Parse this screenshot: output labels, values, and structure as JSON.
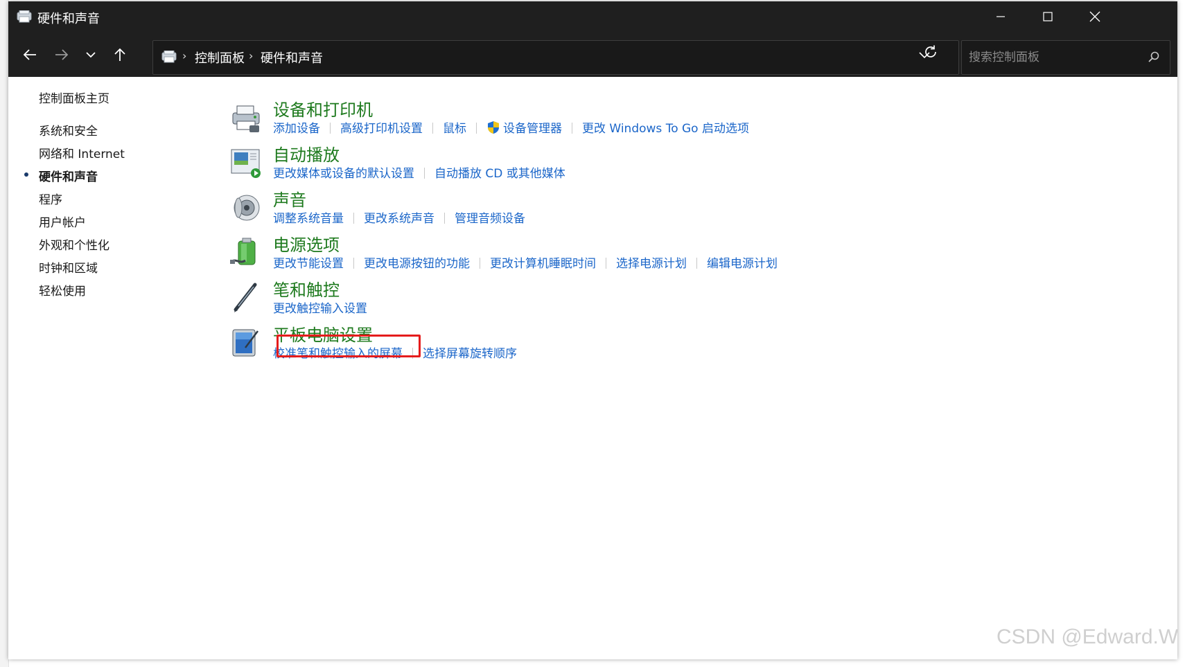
{
  "window": {
    "title": "硬件和声音",
    "controls": {
      "minimize_icon": "minimize-icon",
      "maximize_icon": "maximize-icon",
      "close_icon": "close-icon"
    }
  },
  "navbar": {
    "breadcrumb": [
      "控制面板",
      "硬件和声音"
    ],
    "search_placeholder": "搜索控制面板"
  },
  "sidebar": {
    "home": "控制面板主页",
    "items": [
      {
        "label": "系统和安全",
        "active": false
      },
      {
        "label": "网络和 Internet",
        "active": false
      },
      {
        "label": "硬件和声音",
        "active": true
      },
      {
        "label": "程序",
        "active": false
      },
      {
        "label": "用户帐户",
        "active": false
      },
      {
        "label": "外观和个性化",
        "active": false
      },
      {
        "label": "时钟和区域",
        "active": false
      },
      {
        "label": "轻松使用",
        "active": false
      }
    ]
  },
  "categories": [
    {
      "title": "设备和打印机",
      "icon": "printer-icon",
      "links": [
        "添加设备",
        "高级打印机设置",
        "鼠标",
        "设备管理器",
        "更改 Windows To Go 启动选项"
      ]
    },
    {
      "title": "自动播放",
      "icon": "autoplay-icon",
      "links": [
        "更改媒体或设备的默认设置",
        "自动播放 CD 或其他媒体"
      ]
    },
    {
      "title": "声音",
      "icon": "speaker-icon",
      "links": [
        "调整系统音量",
        "更改系统声音",
        "管理音频设备"
      ]
    },
    {
      "title": "电源选项",
      "icon": "battery-icon",
      "links": [
        "更改节能设置",
        "更改电源按钮的功能",
        "更改计算机睡眠时间",
        "选择电源计划",
        "编辑电源计划"
      ]
    },
    {
      "title": "笔和触控",
      "icon": "pen-icon",
      "links": [
        "更改触控输入设置"
      ]
    },
    {
      "title": "平板电脑设置",
      "icon": "tablet-icon",
      "links": [
        "校准笔和触控输入的屏幕",
        "选择屏幕旋转顺序"
      ]
    }
  ],
  "colors": {
    "link": "#1b66c9",
    "category_title": "#1e7a1e",
    "highlight": "#e51c1c",
    "titlebar": "#1f1f1f"
  },
  "watermark": "CSDN @Edward.W"
}
